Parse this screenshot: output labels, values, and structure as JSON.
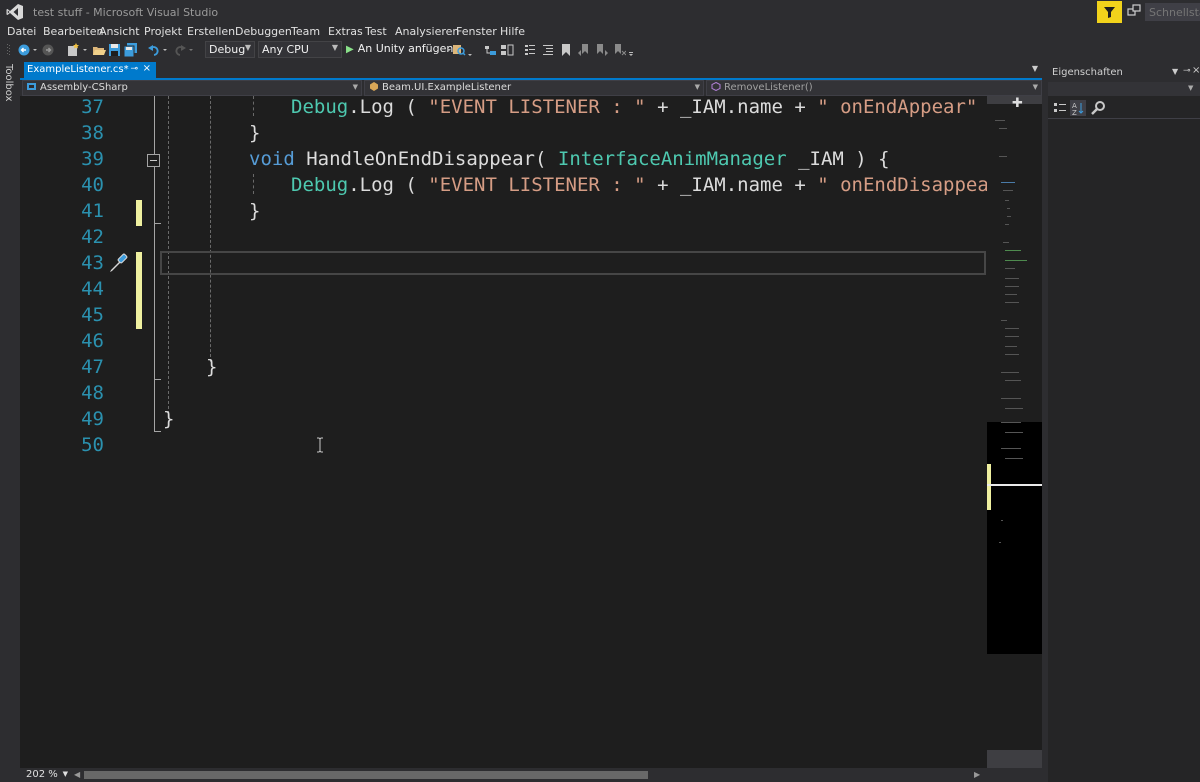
{
  "window": {
    "title": "test stuff - Microsoft Visual Studio",
    "quick_launch_placeholder": "Schnellstart (St"
  },
  "menu": [
    "Datei",
    "Bearbeiten",
    "Ansicht",
    "Projekt",
    "Erstellen",
    "Debuggen",
    "Team",
    "Extras",
    "Test",
    "Analysieren",
    "Fenster",
    "Hilfe"
  ],
  "toolbar": {
    "configuration": "Debug",
    "platform": "Any CPU",
    "run_label": "An Unity anfügen"
  },
  "toolbox": {
    "label": "Toolbox"
  },
  "editor_tab": {
    "label": "ExampleListener.cs*"
  },
  "navbar": {
    "project": "Assembly-CSharp",
    "type": "Beam.UI.ExampleListener",
    "member": "RemoveListener()"
  },
  "code": {
    "line_numbers": [
      "37",
      "38",
      "39",
      "40",
      "41",
      "42",
      "43",
      "44",
      "45",
      "46",
      "47",
      "48",
      "49",
      "50"
    ],
    "line37": {
      "a": "Debug",
      "b": ".Log ( ",
      "c": "\"EVENT LISTENER : \"",
      "d": " + _IAM.name + ",
      "e": "\" onEndAppear\"",
      "f": " );"
    },
    "line38": "}",
    "line39": {
      "a": "void",
      "b": " HandleOnEndDisappear( ",
      "c": "InterfaceAnimManager",
      "d": " _IAM ) {"
    },
    "line40": {
      "a": "Debug",
      "b": ".Log ( ",
      "c": "\"EVENT LISTENER : \"",
      "d": " + _IAM.name + ",
      "e": "\" onEndDisappear\""
    },
    "line41": "}",
    "line47": "}",
    "line49": "}"
  },
  "statusbar": {
    "zoom": "202 %"
  },
  "properties": {
    "title": "Eigenschaften"
  },
  "colors": {
    "accent": "#007acc",
    "line_number": "#2b91af",
    "keyword": "#569cd6",
    "type": "#4ec9b0",
    "string": "#d69d85",
    "change_marker": "#eff0a0",
    "filter_badge": "#f2d31b"
  }
}
